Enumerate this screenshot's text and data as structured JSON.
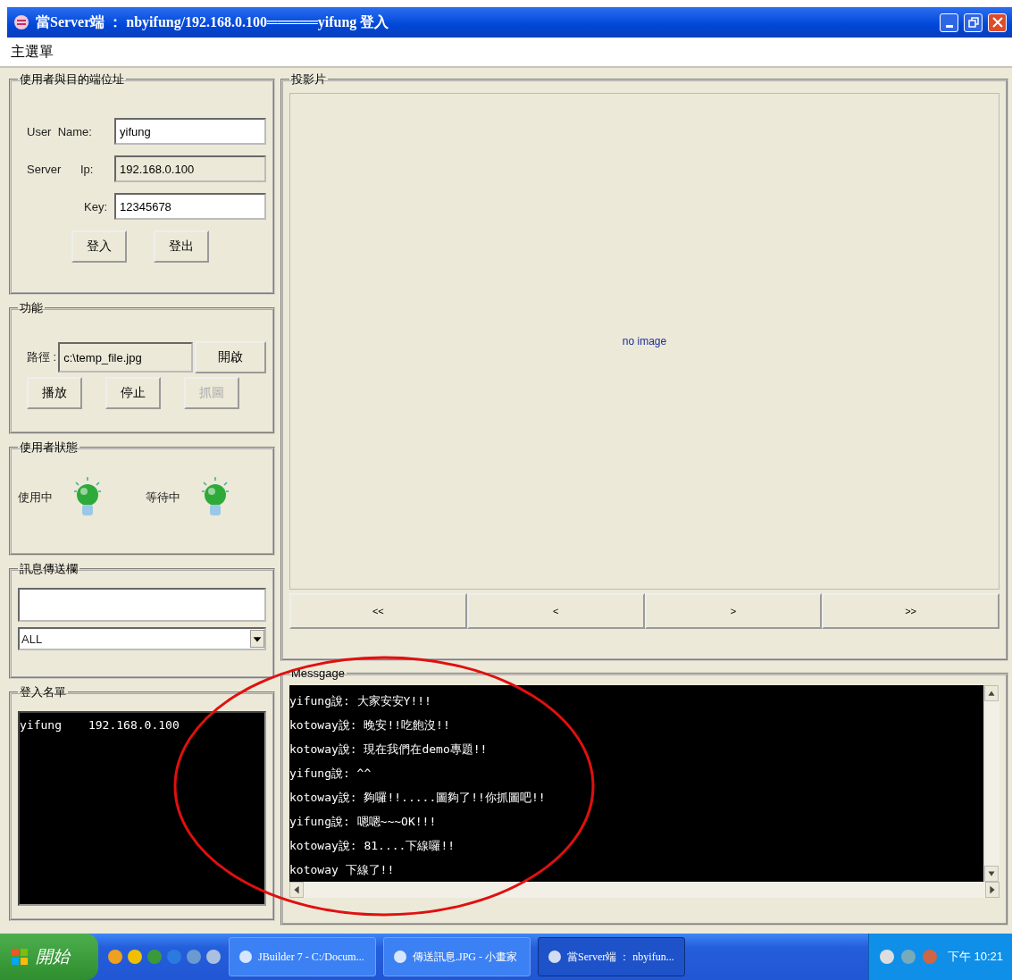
{
  "window": {
    "title": "當Server端 ： nbyifung/192.168.0.100═════yifung  登入"
  },
  "menu": [
    {
      "label": "主選單"
    }
  ],
  "user_panel": {
    "title": "使用者與目的端位址",
    "fields": [
      {
        "label": "User  Name:",
        "value": "yifung",
        "editable": true
      },
      {
        "label": "Server      Ip:",
        "value": "192.168.0.100",
        "editable": false
      },
      {
        "label": "Key:",
        "value": "12345678",
        "editable": true
      }
    ],
    "buttons": [
      {
        "label": "登入"
      },
      {
        "label": "登出"
      }
    ]
  },
  "function_panel": {
    "title": "功能",
    "path_label": "路徑 :",
    "path_value": "c:\\temp_file.jpg",
    "buttons": [
      {
        "label": "開啟",
        "disabled": false
      },
      {
        "label": "播放",
        "disabled": false
      },
      {
        "label": "停止",
        "disabled": false
      },
      {
        "label": "抓圖",
        "disabled": true
      }
    ]
  },
  "status_panel": {
    "title": "使用者狀態",
    "indicators": [
      {
        "label": "使用中",
        "on": true
      },
      {
        "label": "等待中",
        "on": true
      }
    ]
  },
  "send_panel": {
    "title": "訊息傳送欄",
    "recipient": "ALL"
  },
  "login_list": {
    "title": "登入名單",
    "rows": [
      {
        "name": "yifung",
        "ip": "192.168.0.100"
      }
    ]
  },
  "slides": {
    "title": "投影片",
    "placeholder": "no image",
    "nav": [
      "<<",
      "<",
      ">",
      ">>"
    ]
  },
  "message": {
    "title": "Messgage",
    "lines": [
      "yifung說: 大家安安Y!!!",
      "kotoway說: 晚安!!吃飽沒!!",
      "kotoway說: 現在我們在demo專題!!",
      "yifung說: ^^",
      "kotoway說: 夠囉!!.....圖夠了!!你抓圖吧!!",
      "yifung說: 嗯嗯~~~OK!!!",
      "kotoway說: 81....下線囉!!",
      "kotoway 下線了!!"
    ]
  },
  "taskbar": {
    "start": "開始",
    "tasks": [
      {
        "label": "JBuilder 7 - C:/Docum...",
        "selected": false
      },
      {
        "label": "傳送訊息.JPG - 小畫家",
        "selected": false
      },
      {
        "label": "當Server端 ： nbyifun...",
        "selected": true
      }
    ],
    "clock": "下午 10:21"
  }
}
